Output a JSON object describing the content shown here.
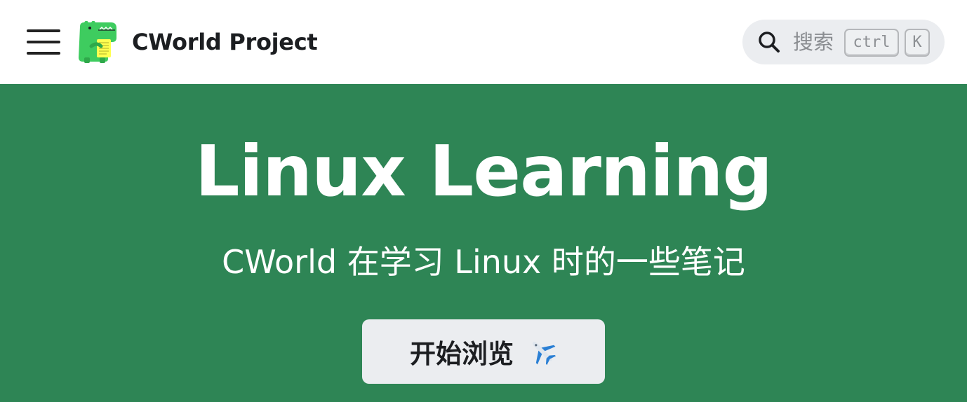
{
  "navbar": {
    "brand_title": "CWorld Project",
    "search": {
      "placeholder": "搜索",
      "key_ctrl": "ctrl",
      "key_k": "K"
    }
  },
  "hero": {
    "title": "Linux Learning",
    "subtitle": "CWorld 在学习 Linux 时的一些笔记",
    "cta_label": "开始浏览",
    "cta_icon": "airplane-icon"
  },
  "colors": {
    "hero_background": "#2e8555",
    "navbar_background": "#ffffff",
    "search_background": "#ebedf0",
    "button_background": "#ebedf0",
    "logo_green": "#3ecc5f"
  },
  "icons": [
    "menu-icon",
    "dinosaur-logo",
    "search-icon",
    "airplane-icon"
  ]
}
